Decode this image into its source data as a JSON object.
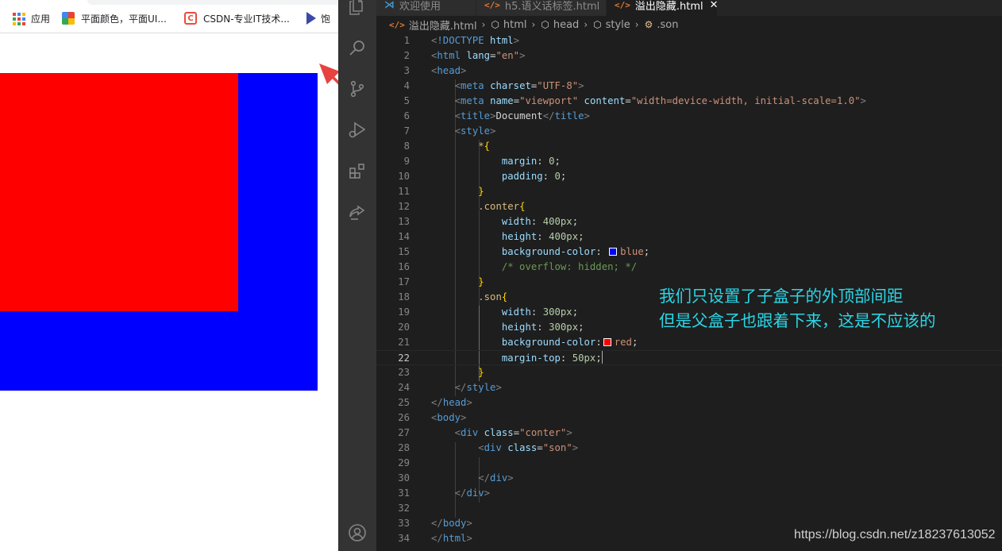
{
  "browser": {
    "bookmarks": [
      {
        "label": "应用",
        "icon": "apps-grid-icon"
      },
      {
        "label": "平面颜色，平面UI...",
        "icon": "color-palette-icon"
      },
      {
        "label": "CSDN-专业IT技术...",
        "icon": "csdn-icon"
      },
      {
        "label": "饱",
        "icon": "bookmark-icon"
      }
    ],
    "demo": {
      "conter_color": "#0000ff",
      "son_color": "#ff0000"
    },
    "arrow_color": "#e64340"
  },
  "vscode": {
    "tabs": [
      {
        "label": "欢迎使用",
        "icon": "vscode-logo-icon",
        "active": false
      },
      {
        "label": "h5.语义话标签.html",
        "icon": "html-file-icon",
        "active": false
      },
      {
        "label": "溢出隐藏.html",
        "icon": "html-file-icon",
        "active": true
      }
    ],
    "breadcrumbs": [
      {
        "label": "溢出隐藏.html",
        "icon": "html-file-icon"
      },
      {
        "label": "html",
        "icon": "cube-icon"
      },
      {
        "label": "head",
        "icon": "cube-icon"
      },
      {
        "label": "style",
        "icon": "cube-icon"
      },
      {
        "label": ".son",
        "icon": "css-rule-icon"
      }
    ],
    "current_line": 22,
    "lines": [
      [
        [
          "t-br",
          "<"
        ],
        [
          "t-tag",
          "!DOCTYPE"
        ],
        [
          "t-txt",
          " "
        ],
        [
          "t-attr",
          "html"
        ],
        [
          "t-br",
          ">"
        ]
      ],
      [
        [
          "t-br",
          "<"
        ],
        [
          "t-tag",
          "html"
        ],
        [
          "t-txt",
          " "
        ],
        [
          "t-attr",
          "lang"
        ],
        [
          "t-txt",
          "="
        ],
        [
          "t-str",
          "\"en\""
        ],
        [
          "t-br",
          ">"
        ]
      ],
      [
        [
          "t-br",
          "<"
        ],
        [
          "t-tag",
          "head"
        ],
        [
          "t-br",
          ">"
        ]
      ],
      [
        [
          "t-txt",
          "    "
        ],
        [
          "t-br",
          "<"
        ],
        [
          "t-tag",
          "meta"
        ],
        [
          "t-txt",
          " "
        ],
        [
          "t-attr",
          "charset"
        ],
        [
          "t-txt",
          "="
        ],
        [
          "t-str",
          "\"UTF-8\""
        ],
        [
          "t-br",
          ">"
        ]
      ],
      [
        [
          "t-txt",
          "    "
        ],
        [
          "t-br",
          "<"
        ],
        [
          "t-tag",
          "meta"
        ],
        [
          "t-txt",
          " "
        ],
        [
          "t-attr",
          "name"
        ],
        [
          "t-txt",
          "="
        ],
        [
          "t-str",
          "\"viewport\""
        ],
        [
          "t-txt",
          " "
        ],
        [
          "t-attr",
          "content"
        ],
        [
          "t-txt",
          "="
        ],
        [
          "t-str",
          "\"width=device-width, initial-scale=1.0\""
        ],
        [
          "t-br",
          ">"
        ]
      ],
      [
        [
          "t-txt",
          "    "
        ],
        [
          "t-br",
          "<"
        ],
        [
          "t-tag",
          "title"
        ],
        [
          "t-br",
          ">"
        ],
        [
          "t-txt",
          "Document"
        ],
        [
          "t-br",
          "</"
        ],
        [
          "t-tag",
          "title"
        ],
        [
          "t-br",
          ">"
        ]
      ],
      [
        [
          "t-txt",
          "    "
        ],
        [
          "t-br",
          "<"
        ],
        [
          "t-tag",
          "style"
        ],
        [
          "t-br",
          ">"
        ]
      ],
      [
        [
          "t-txt",
          "        "
        ],
        [
          "t-sel",
          "*"
        ],
        [
          "t-brace",
          "{"
        ]
      ],
      [
        [
          "t-txt",
          "            "
        ],
        [
          "t-prop",
          "margin"
        ],
        [
          "t-txt",
          ": "
        ],
        [
          "t-num",
          "0"
        ],
        [
          "t-txt",
          ";"
        ]
      ],
      [
        [
          "t-txt",
          "            "
        ],
        [
          "t-prop",
          "padding"
        ],
        [
          "t-txt",
          ": "
        ],
        [
          "t-num",
          "0"
        ],
        [
          "t-txt",
          ";"
        ]
      ],
      [
        [
          "t-txt",
          "        "
        ],
        [
          "t-brace",
          "}"
        ]
      ],
      [
        [
          "t-txt",
          "        "
        ],
        [
          "t-sel",
          ".conter"
        ],
        [
          "t-brace",
          "{"
        ]
      ],
      [
        [
          "t-txt",
          "            "
        ],
        [
          "t-prop",
          "width"
        ],
        [
          "t-txt",
          ": "
        ],
        [
          "t-num",
          "400px"
        ],
        [
          "t-txt",
          ";"
        ]
      ],
      [
        [
          "t-txt",
          "            "
        ],
        [
          "t-prop",
          "height"
        ],
        [
          "t-txt",
          ": "
        ],
        [
          "t-num",
          "400px"
        ],
        [
          "t-txt",
          ";"
        ]
      ],
      [
        [
          "t-txt",
          "            "
        ],
        [
          "t-prop",
          "background-color"
        ],
        [
          "t-txt",
          ": "
        ],
        [
          "swatch",
          "#0000ff"
        ],
        [
          "t-val",
          "blue"
        ],
        [
          "t-txt",
          ";"
        ]
      ],
      [
        [
          "t-txt",
          "            "
        ],
        [
          "t-com",
          "/* overflow: hidden; */"
        ]
      ],
      [
        [
          "t-txt",
          "        "
        ],
        [
          "t-brace",
          "}"
        ]
      ],
      [
        [
          "t-txt",
          "        "
        ],
        [
          "t-sel",
          ".son"
        ],
        [
          "t-brace",
          "{"
        ]
      ],
      [
        [
          "t-txt",
          "            "
        ],
        [
          "t-prop",
          "width"
        ],
        [
          "t-txt",
          ": "
        ],
        [
          "t-num",
          "300px"
        ],
        [
          "t-txt",
          ";"
        ]
      ],
      [
        [
          "t-txt",
          "            "
        ],
        [
          "t-prop",
          "height"
        ],
        [
          "t-txt",
          ": "
        ],
        [
          "t-num",
          "300px"
        ],
        [
          "t-txt",
          ";"
        ]
      ],
      [
        [
          "t-txt",
          "            "
        ],
        [
          "t-prop",
          "background-color"
        ],
        [
          "t-txt",
          ":"
        ],
        [
          "swatch",
          "#ff0000"
        ],
        [
          "t-val",
          "red"
        ],
        [
          "t-txt",
          ";"
        ]
      ],
      [
        [
          "t-txt",
          "            "
        ],
        [
          "t-prop",
          "margin-top"
        ],
        [
          "t-txt",
          ": "
        ],
        [
          "t-num",
          "50px"
        ],
        [
          "t-txt",
          ";"
        ],
        [
          "cursor",
          ""
        ]
      ],
      [
        [
          "t-txt",
          "        "
        ],
        [
          "t-brace",
          "}"
        ]
      ],
      [
        [
          "t-txt",
          "    "
        ],
        [
          "t-br",
          "</"
        ],
        [
          "t-tag",
          "style"
        ],
        [
          "t-br",
          ">"
        ]
      ],
      [
        [
          "t-br",
          "</"
        ],
        [
          "t-tag",
          "head"
        ],
        [
          "t-br",
          ">"
        ]
      ],
      [
        [
          "t-br",
          "<"
        ],
        [
          "t-tag",
          "body"
        ],
        [
          "t-br",
          ">"
        ]
      ],
      [
        [
          "t-txt",
          "    "
        ],
        [
          "t-br",
          "<"
        ],
        [
          "t-tag",
          "div"
        ],
        [
          "t-txt",
          " "
        ],
        [
          "t-attr",
          "class"
        ],
        [
          "t-txt",
          "="
        ],
        [
          "t-str",
          "\"conter\""
        ],
        [
          "t-br",
          ">"
        ]
      ],
      [
        [
          "t-txt",
          "        "
        ],
        [
          "t-br",
          "<"
        ],
        [
          "t-tag",
          "div"
        ],
        [
          "t-txt",
          " "
        ],
        [
          "t-attr",
          "class"
        ],
        [
          "t-txt",
          "="
        ],
        [
          "t-str",
          "\"son\""
        ],
        [
          "t-br",
          ">"
        ]
      ],
      [],
      [
        [
          "t-txt",
          "        "
        ],
        [
          "t-br",
          "</"
        ],
        [
          "t-tag",
          "div"
        ],
        [
          "t-br",
          ">"
        ]
      ],
      [
        [
          "t-txt",
          "    "
        ],
        [
          "t-br",
          "</"
        ],
        [
          "t-tag",
          "div"
        ],
        [
          "t-br",
          ">"
        ]
      ],
      [],
      [
        [
          "t-br",
          "</"
        ],
        [
          "t-tag",
          "body"
        ],
        [
          "t-br",
          ">"
        ]
      ],
      [
        [
          "t-br",
          "</"
        ],
        [
          "t-tag",
          "html"
        ],
        [
          "t-br",
          ">"
        ]
      ]
    ]
  },
  "annotation": {
    "line1": "我们只设置了子盒子的外顶部间距",
    "line2": "但是父盒子也跟着下来，这是不应该的"
  },
  "watermark": "https://blog.csdn.net/z18237613052"
}
